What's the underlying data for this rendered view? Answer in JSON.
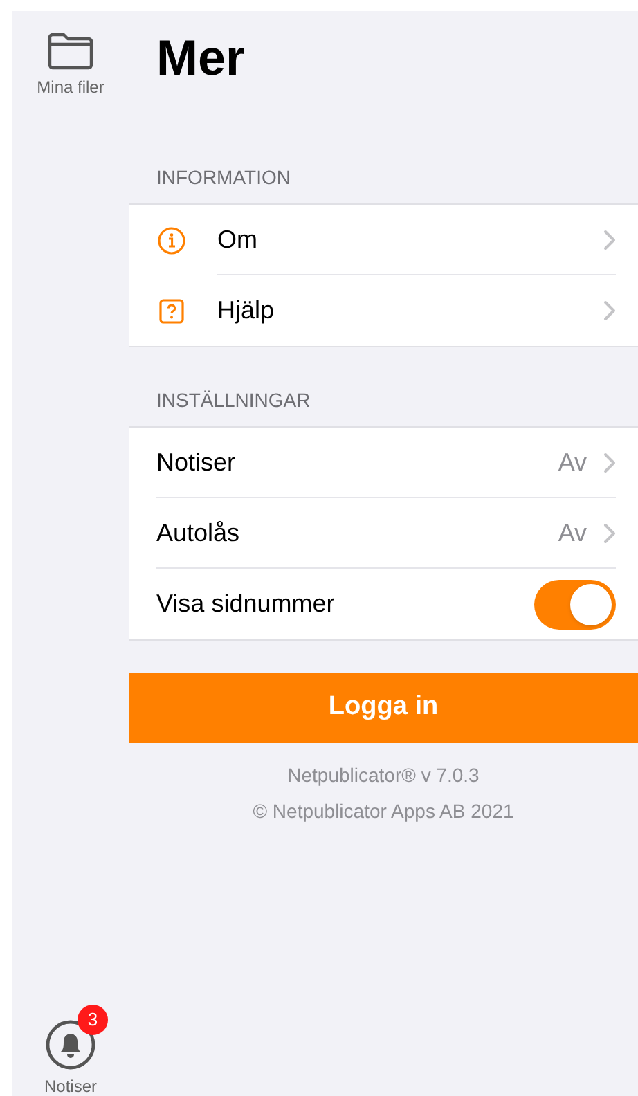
{
  "sidebar": {
    "items": [
      {
        "kind": "files",
        "label": "Mina filer",
        "selected": false
      },
      {
        "kind": "notifications",
        "label": "Notiser",
        "badge": "3",
        "selected": false
      }
    ]
  },
  "title": "Mer",
  "sections": [
    {
      "header": "INFORMATION",
      "rows": [
        {
          "kind": "info",
          "label": "Om"
        },
        {
          "kind": "help",
          "label": "Hjälp"
        }
      ]
    },
    {
      "header": "INSTÄLLNINGAR",
      "rows": [
        {
          "kind": "value",
          "label": "Notiser",
          "value": "Av"
        },
        {
          "kind": "value",
          "label": "Autolås",
          "value": "Av"
        },
        {
          "kind": "toggle",
          "label": "Visa sidnummer",
          "on": true
        }
      ]
    }
  ],
  "login_button": "Logga in",
  "footer": [
    "Netpublicator® v 7.0.3",
    "© Netpublicator Apps AB 2021"
  ]
}
